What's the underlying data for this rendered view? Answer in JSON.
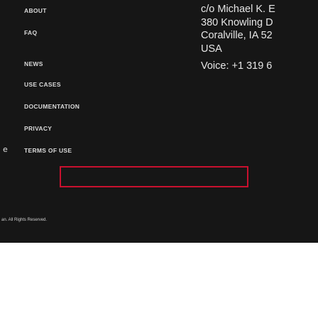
{
  "footer_nav": {
    "items": [
      {
        "label": "ABOUT"
      },
      {
        "label": "FAQ"
      },
      {
        "label": "NEWS"
      },
      {
        "label": "USE CASES"
      },
      {
        "label": "DOCUMENTATION"
      },
      {
        "label": "PRIVACY"
      },
      {
        "label": "TERMS OF USE"
      }
    ],
    "terms_icon": "e"
  },
  "contact": {
    "line1": "c/o Michael K. E",
    "line2": "380 Knowling D",
    "line3": "Coralville, IA 52",
    "line4": "USA",
    "voice": "Voice: +1 319 6"
  },
  "form": {
    "input_value": "",
    "accent_color": "#c8102e"
  },
  "footer": {
    "copyright": "an. All Rights Reserved."
  },
  "colors": {
    "background_dark": "#161616",
    "page_background": "#ffffff",
    "text_light": "#d8d8d8"
  }
}
